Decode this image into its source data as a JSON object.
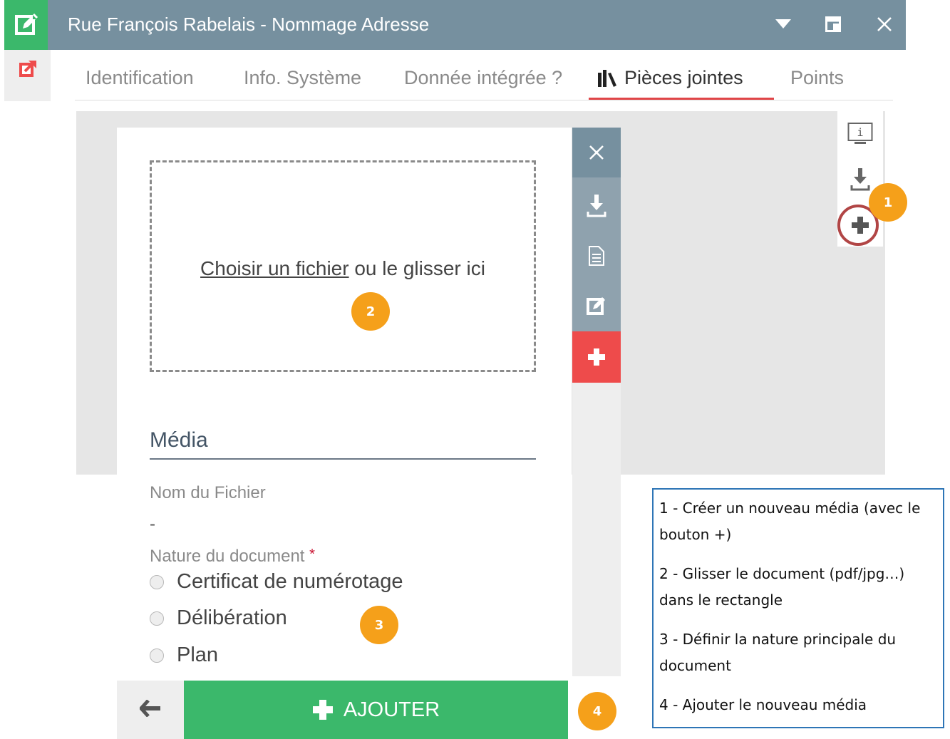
{
  "window": {
    "title": "Rue François Rabelais - Nommage Adresse"
  },
  "tabs": [
    {
      "label": "Identification",
      "active": false
    },
    {
      "label": "Info. Système",
      "active": false
    },
    {
      "label": "Donnée intégrée ?",
      "active": false
    },
    {
      "label": "Pièces jointes",
      "active": true
    },
    {
      "label": "Points",
      "active": false
    }
  ],
  "dropzone": {
    "link_text": "Choisir un fichier",
    "rest_text": " ou le glisser ici"
  },
  "media_section": {
    "title": "Média",
    "filename_label": "Nom du Fichier",
    "filename_value": "-",
    "nature_label": "Nature du document",
    "required_marker": "*",
    "options": [
      "Certificat de numérotage",
      "Délibération",
      "Plan"
    ]
  },
  "footer": {
    "add_label": "AJOUTER"
  },
  "badges": [
    "1",
    "2",
    "3",
    "4"
  ],
  "legend": [
    "1 - Créer un nouveau média (avec le bouton +)",
    "2 - Glisser le document (pdf/jpg…) dans le rectangle",
    "3 - Définir la nature principale du document",
    "4 - Ajouter le nouveau média"
  ],
  "colors": {
    "title_bar": "#76909f",
    "green": "#3bb86b",
    "red": "#ee4b4b",
    "badge": "#f5a01a",
    "legend_border": "#2e75b6"
  },
  "icons": {
    "app": "edit-square-icon",
    "open_external": "external-link-icon",
    "dropdown": "caret-down-icon",
    "maximize": "window-maximize-icon",
    "close": "close-icon",
    "tab_attachments": "books-icon",
    "info": "info-monitor-icon",
    "download": "download-icon",
    "add": "plus-icon",
    "document": "file-icon",
    "edit": "edit-icon",
    "back": "arrow-left-icon"
  }
}
